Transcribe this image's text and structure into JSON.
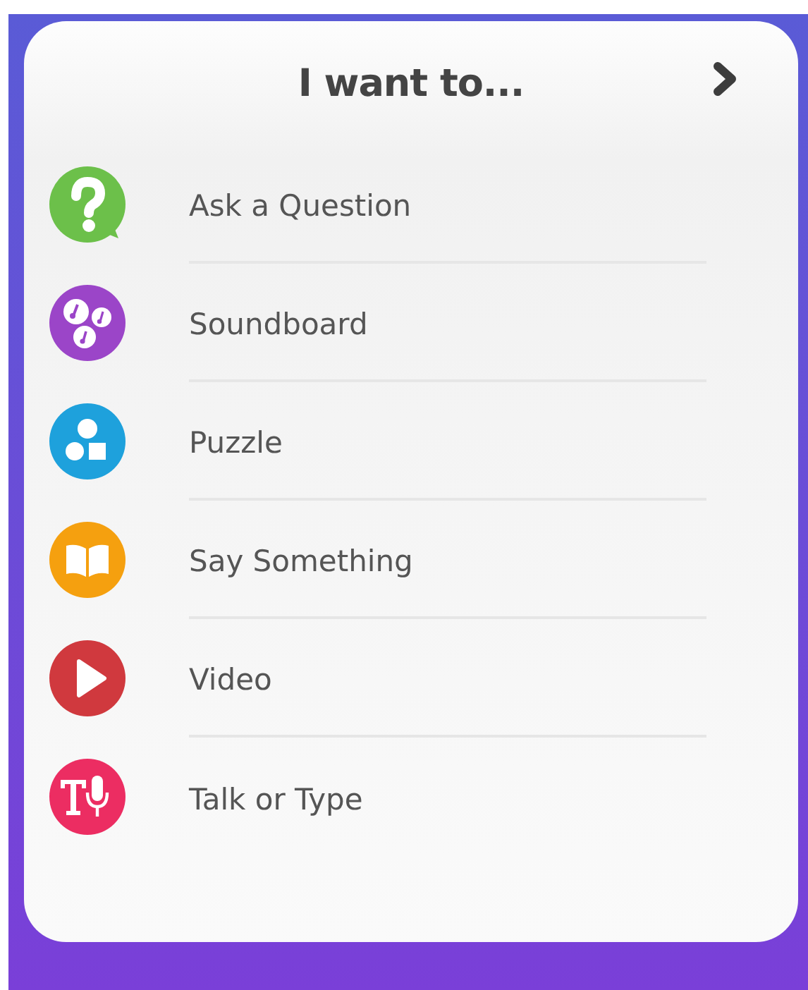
{
  "panel": {
    "title": "I want to..."
  },
  "items": [
    {
      "label": "Ask a Question",
      "kind": "question",
      "color": "#6cc04a"
    },
    {
      "label": "Soundboard",
      "kind": "music",
      "color": "#9b45c8"
    },
    {
      "label": "Puzzle",
      "kind": "shapes",
      "color": "#1ea1dc"
    },
    {
      "label": "Say Something",
      "kind": "book",
      "color": "#f5a00f"
    },
    {
      "label": "Video",
      "kind": "play",
      "color": "#d0393e"
    },
    {
      "label": "Talk or Type",
      "kind": "mic",
      "color": "#ec2d62"
    }
  ]
}
